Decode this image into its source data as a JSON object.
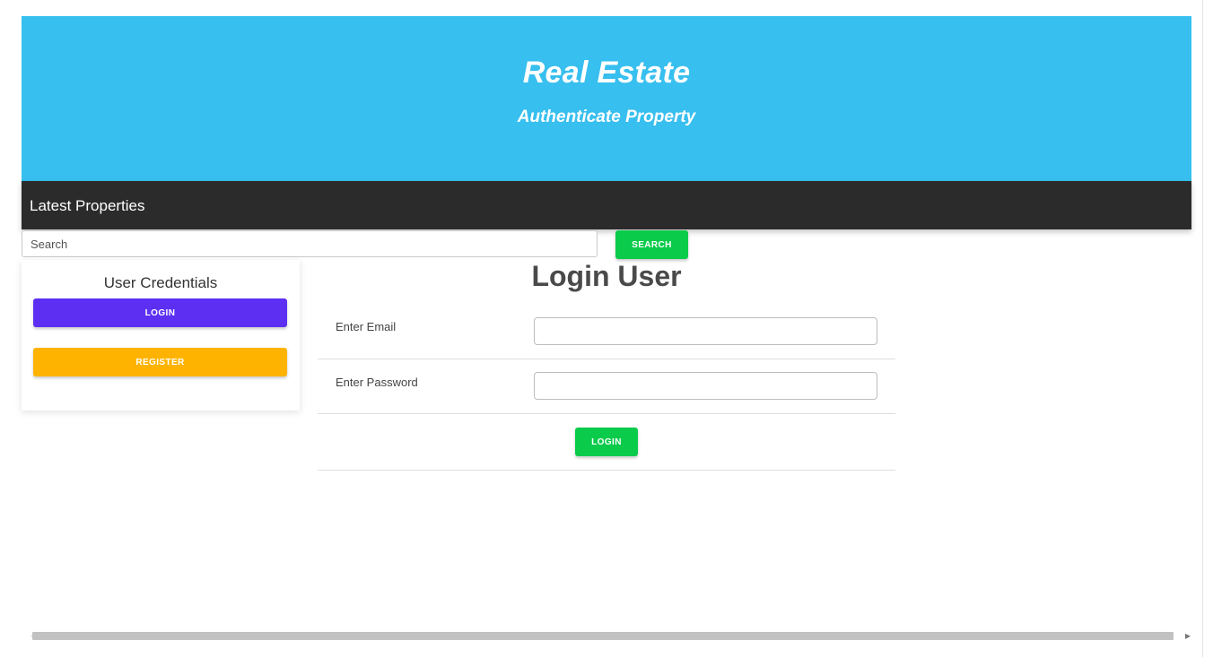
{
  "header": {
    "title": "Real Estate",
    "subtitle": "Authenticate Property"
  },
  "navbar": {
    "title": "Latest Properties"
  },
  "search": {
    "placeholder": "Search",
    "button_label": "SEARCH"
  },
  "sidebar": {
    "title": "User Credentials",
    "login_label": "LOGIN",
    "register_label": "REGISTER"
  },
  "login_form": {
    "title": "Login User",
    "email_label": "Enter Email",
    "email_value": "",
    "password_label": "Enter Password",
    "password_value": "",
    "submit_label": "LOGIN"
  },
  "scrollbar": {
    "left_arrow": "◀",
    "right_arrow": "▶"
  },
  "colors": {
    "hero_bg": "#37bfef",
    "navbar_bg": "#2b2b2b",
    "search_button": "#0bcb4b",
    "login_button": "#5c2ff3",
    "register_button": "#fdb300",
    "submit_button": "#0bcb4b"
  }
}
